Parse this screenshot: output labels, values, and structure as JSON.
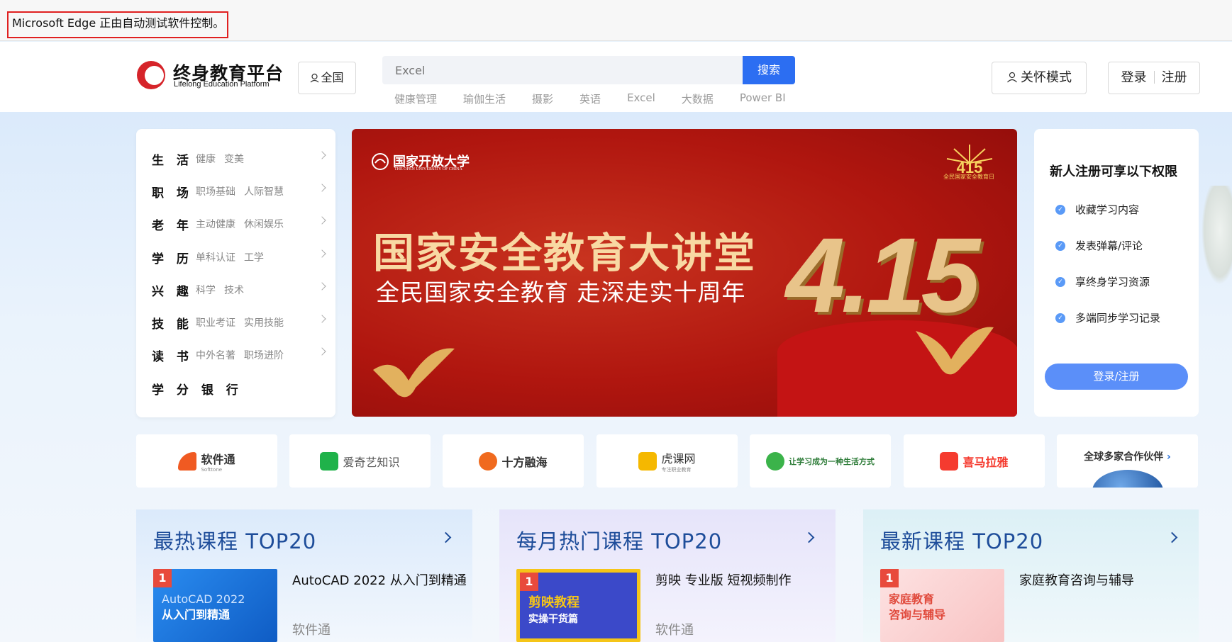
{
  "browser": {
    "automation_notice": "Microsoft Edge 正由自动测试软件控制。"
  },
  "header": {
    "logo_title": "终身教育平台",
    "logo_subtitle": "Lifelong Education Platform",
    "region_label": "全国",
    "search_placeholder": "Excel",
    "search_button": "搜索",
    "hot_tags": [
      "健康管理",
      "瑜伽生活",
      "摄影",
      "英语",
      "Excel",
      "大数据",
      "Power BI"
    ],
    "care_mode": "关怀模式",
    "login": "登录",
    "register": "注册"
  },
  "categories": [
    {
      "name": "生 活",
      "subs": [
        "健康",
        "变美"
      ],
      "has_arrow": true
    },
    {
      "name": "职 场",
      "subs": [
        "职场基础",
        "人际智慧"
      ],
      "has_arrow": true
    },
    {
      "name": "老 年",
      "subs": [
        "主动健康",
        "休闲娱乐"
      ],
      "has_arrow": true
    },
    {
      "name": "学 历",
      "subs": [
        "单科认证",
        "工学"
      ],
      "has_arrow": true
    },
    {
      "name": "兴 趣",
      "subs": [
        "科学",
        "技术"
      ],
      "has_arrow": true
    },
    {
      "name": "技 能",
      "subs": [
        "职业考证",
        "实用技能"
      ],
      "has_arrow": true
    },
    {
      "name": "读 书",
      "subs": [
        "中外名著",
        "职场进阶"
      ],
      "has_arrow": true
    },
    {
      "name": "学 分 银 行",
      "subs": [],
      "has_arrow": false
    }
  ],
  "banner": {
    "university": "国家开放大学",
    "university_en": "THE OPEN UNIVERSITY OF CHINA",
    "headline": "国家安全教育大讲堂",
    "subheadline": "全民国家安全教育 走深走实十周年",
    "date": "4.15",
    "seal_text": "全民国家安全教育日",
    "colors": {
      "primary": "#b0160f",
      "gold": "#f8d9a3"
    }
  },
  "perks": {
    "title": "新人注册可享以下权限",
    "items": [
      "收藏学习内容",
      "发表弹幕/评论",
      "享终身学习资源",
      "多端同步学习记录"
    ],
    "button": "登录/注册"
  },
  "partners": [
    {
      "name": "软件通",
      "sub": "Softtone",
      "icon": "softtone-logo",
      "color": "#f05a22"
    },
    {
      "name": "爱奇艺知识",
      "sub": "",
      "icon": "iqiyi-logo",
      "color": "#1fb24a"
    },
    {
      "name": "十方融海",
      "sub": "",
      "icon": "shifang-logo",
      "color": "#f06a1e"
    },
    {
      "name": "虎课网",
      "sub": "专注职业教育",
      "icon": "huke-logo",
      "color": "#f5b800"
    },
    {
      "name": "让学习成为一种生活方式",
      "sub": "",
      "icon": "learning-logo",
      "color": "#3bb34a"
    },
    {
      "name": "喜马拉雅",
      "sub": "",
      "icon": "ximalaya-logo",
      "color": "#f53b2f"
    },
    {
      "name": "全球多家合作伙伴",
      "sub": "",
      "icon": "globe-icon",
      "color": "#1a66d6"
    }
  ],
  "rankings": [
    {
      "title": "最热课程 TOP20",
      "rank": "1",
      "course": "AutoCAD 2022 从入门到精通",
      "provider": "软件通",
      "thumb_text": "AutoCAD 2022\n从入门到精通",
      "thumb_color": "#1a78e6"
    },
    {
      "title": "每月热门课程 TOP20",
      "rank": "1",
      "course": "剪映 专业版 短视频制作",
      "provider": "软件通",
      "thumb_text": "剪映教程\n实操干货篇",
      "thumb_color": "#3b49c9"
    },
    {
      "title": "最新课程 TOP20",
      "rank": "1",
      "course": "家庭教育咨询与辅导",
      "provider": "",
      "thumb_text": "家庭教育\n咨询与辅导",
      "thumb_color": "#fbd4d4"
    }
  ]
}
